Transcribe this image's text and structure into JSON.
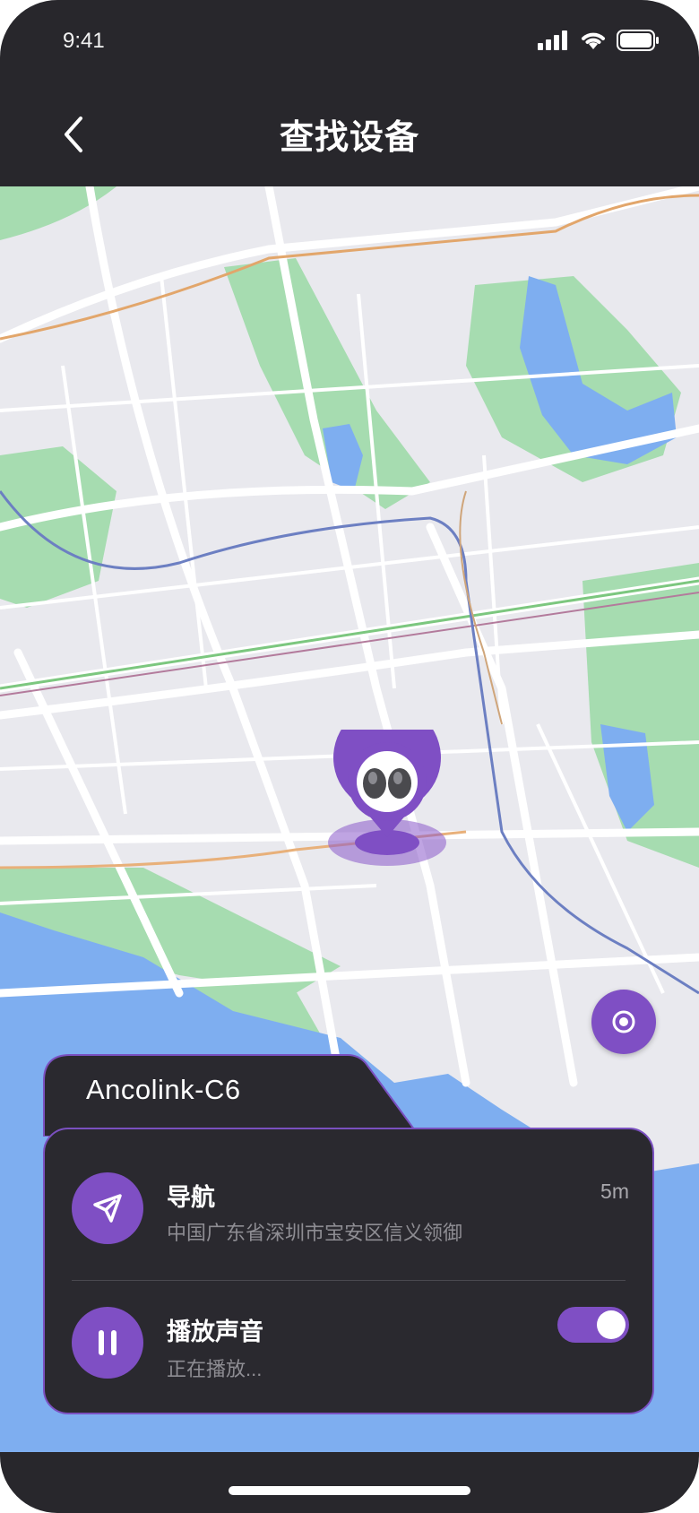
{
  "status_bar": {
    "time": "9:41"
  },
  "header": {
    "title": "查找设备"
  },
  "device": {
    "name": "Ancolink-C6"
  },
  "actions": {
    "navigation": {
      "title": "导航",
      "address": "中国广东省深圳市宝安区信义领御",
      "distance": "5m"
    },
    "sound": {
      "title": "播放声音",
      "status": "正在播放...",
      "enabled": true
    }
  },
  "colors": {
    "accent": "#7f4fc4",
    "background": "#28272c",
    "card": "#2a292f",
    "map_land": "#e9e9ee",
    "map_green": "#a6dcb0",
    "map_water": "#7eaef0"
  },
  "icons": {
    "back": "chevron-left-icon",
    "navigate": "paper-plane-icon",
    "sound": "pause-icon",
    "locate": "target-icon"
  }
}
